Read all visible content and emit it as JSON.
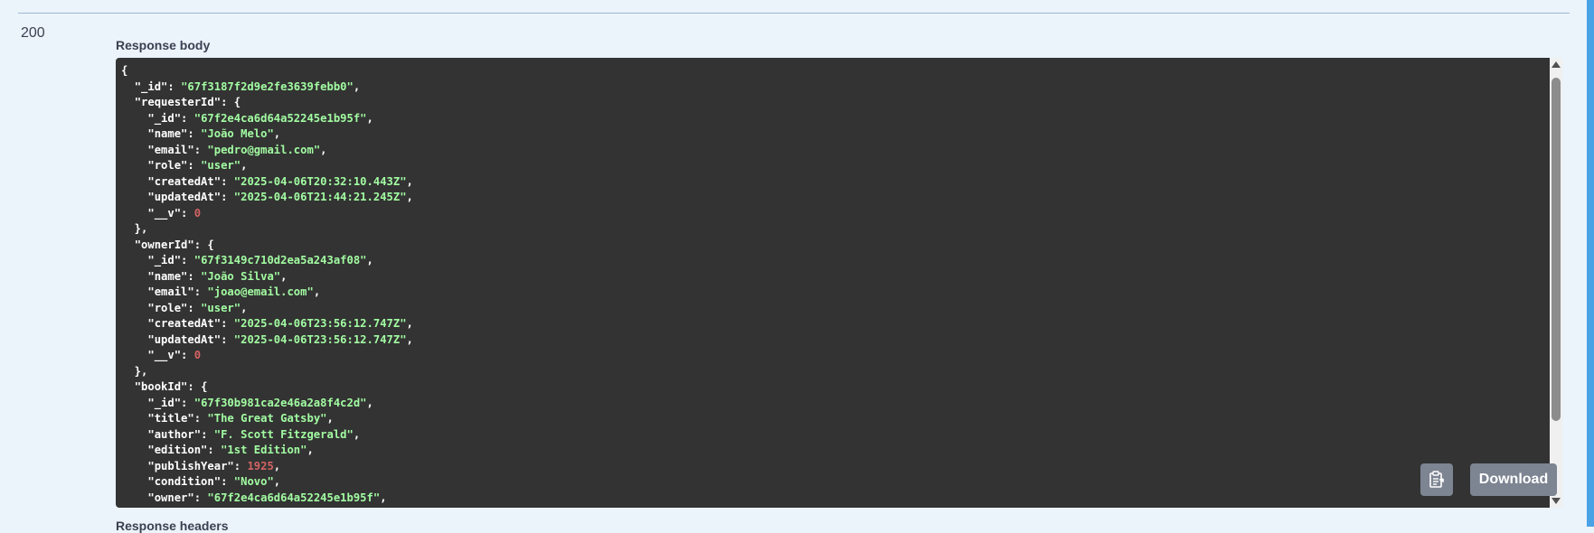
{
  "response": {
    "status_code": "200",
    "body_label": "Response body",
    "headers_label": "Response headers",
    "download_label": "Download"
  },
  "icons": {
    "copy": "clipboard-icon",
    "scroll_up": "scroll-up-arrow-icon",
    "scroll_down": "scroll-down-arrow-icon"
  },
  "colors": {
    "code_background": "#333333",
    "string_value": "#a2fca2",
    "number_value": "#d36363",
    "key_text": "#ffffff",
    "button_background": "#7d8492"
  },
  "json_lines": [
    [
      {
        "t": "p",
        "v": "{"
      }
    ],
    [
      {
        "t": "p",
        "v": "  "
      },
      {
        "t": "k",
        "v": "\"_id\""
      },
      {
        "t": "p",
        "v": ": "
      },
      {
        "t": "s",
        "v": "\"67f3187f2d9e2fe3639febb0\""
      },
      {
        "t": "p",
        "v": ","
      }
    ],
    [
      {
        "t": "p",
        "v": "  "
      },
      {
        "t": "k",
        "v": "\"requesterId\""
      },
      {
        "t": "p",
        "v": ": {"
      }
    ],
    [
      {
        "t": "p",
        "v": "    "
      },
      {
        "t": "k",
        "v": "\"_id\""
      },
      {
        "t": "p",
        "v": ": "
      },
      {
        "t": "s",
        "v": "\"67f2e4ca6d64a52245e1b95f\""
      },
      {
        "t": "p",
        "v": ","
      }
    ],
    [
      {
        "t": "p",
        "v": "    "
      },
      {
        "t": "k",
        "v": "\"name\""
      },
      {
        "t": "p",
        "v": ": "
      },
      {
        "t": "s",
        "v": "\"João Melo\""
      },
      {
        "t": "p",
        "v": ","
      }
    ],
    [
      {
        "t": "p",
        "v": "    "
      },
      {
        "t": "k",
        "v": "\"email\""
      },
      {
        "t": "p",
        "v": ": "
      },
      {
        "t": "s",
        "v": "\"pedro@gmail.com\""
      },
      {
        "t": "p",
        "v": ","
      }
    ],
    [
      {
        "t": "p",
        "v": "    "
      },
      {
        "t": "k",
        "v": "\"role\""
      },
      {
        "t": "p",
        "v": ": "
      },
      {
        "t": "s",
        "v": "\"user\""
      },
      {
        "t": "p",
        "v": ","
      }
    ],
    [
      {
        "t": "p",
        "v": "    "
      },
      {
        "t": "k",
        "v": "\"createdAt\""
      },
      {
        "t": "p",
        "v": ": "
      },
      {
        "t": "s",
        "v": "\"2025-04-06T20:32:10.443Z\""
      },
      {
        "t": "p",
        "v": ","
      }
    ],
    [
      {
        "t": "p",
        "v": "    "
      },
      {
        "t": "k",
        "v": "\"updatedAt\""
      },
      {
        "t": "p",
        "v": ": "
      },
      {
        "t": "s",
        "v": "\"2025-04-06T21:44:21.245Z\""
      },
      {
        "t": "p",
        "v": ","
      }
    ],
    [
      {
        "t": "p",
        "v": "    "
      },
      {
        "t": "k",
        "v": "\"__v\""
      },
      {
        "t": "p",
        "v": ": "
      },
      {
        "t": "n",
        "v": "0"
      }
    ],
    [
      {
        "t": "p",
        "v": "  },"
      }
    ],
    [
      {
        "t": "p",
        "v": "  "
      },
      {
        "t": "k",
        "v": "\"ownerId\""
      },
      {
        "t": "p",
        "v": ": {"
      }
    ],
    [
      {
        "t": "p",
        "v": "    "
      },
      {
        "t": "k",
        "v": "\"_id\""
      },
      {
        "t": "p",
        "v": ": "
      },
      {
        "t": "s",
        "v": "\"67f3149c710d2ea5a243af08\""
      },
      {
        "t": "p",
        "v": ","
      }
    ],
    [
      {
        "t": "p",
        "v": "    "
      },
      {
        "t": "k",
        "v": "\"name\""
      },
      {
        "t": "p",
        "v": ": "
      },
      {
        "t": "s",
        "v": "\"João Silva\""
      },
      {
        "t": "p",
        "v": ","
      }
    ],
    [
      {
        "t": "p",
        "v": "    "
      },
      {
        "t": "k",
        "v": "\"email\""
      },
      {
        "t": "p",
        "v": ": "
      },
      {
        "t": "s",
        "v": "\"joao@email.com\""
      },
      {
        "t": "p",
        "v": ","
      }
    ],
    [
      {
        "t": "p",
        "v": "    "
      },
      {
        "t": "k",
        "v": "\"role\""
      },
      {
        "t": "p",
        "v": ": "
      },
      {
        "t": "s",
        "v": "\"user\""
      },
      {
        "t": "p",
        "v": ","
      }
    ],
    [
      {
        "t": "p",
        "v": "    "
      },
      {
        "t": "k",
        "v": "\"createdAt\""
      },
      {
        "t": "p",
        "v": ": "
      },
      {
        "t": "s",
        "v": "\"2025-04-06T23:56:12.747Z\""
      },
      {
        "t": "p",
        "v": ","
      }
    ],
    [
      {
        "t": "p",
        "v": "    "
      },
      {
        "t": "k",
        "v": "\"updatedAt\""
      },
      {
        "t": "p",
        "v": ": "
      },
      {
        "t": "s",
        "v": "\"2025-04-06T23:56:12.747Z\""
      },
      {
        "t": "p",
        "v": ","
      }
    ],
    [
      {
        "t": "p",
        "v": "    "
      },
      {
        "t": "k",
        "v": "\"__v\""
      },
      {
        "t": "p",
        "v": ": "
      },
      {
        "t": "n",
        "v": "0"
      }
    ],
    [
      {
        "t": "p",
        "v": "  },"
      }
    ],
    [
      {
        "t": "p",
        "v": "  "
      },
      {
        "t": "k",
        "v": "\"bookId\""
      },
      {
        "t": "p",
        "v": ": {"
      }
    ],
    [
      {
        "t": "p",
        "v": "    "
      },
      {
        "t": "k",
        "v": "\"_id\""
      },
      {
        "t": "p",
        "v": ": "
      },
      {
        "t": "s",
        "v": "\"67f30b981ca2e46a2a8f4c2d\""
      },
      {
        "t": "p",
        "v": ","
      }
    ],
    [
      {
        "t": "p",
        "v": "    "
      },
      {
        "t": "k",
        "v": "\"title\""
      },
      {
        "t": "p",
        "v": ": "
      },
      {
        "t": "s",
        "v": "\"The Great Gatsby\""
      },
      {
        "t": "p",
        "v": ","
      }
    ],
    [
      {
        "t": "p",
        "v": "    "
      },
      {
        "t": "k",
        "v": "\"author\""
      },
      {
        "t": "p",
        "v": ": "
      },
      {
        "t": "s",
        "v": "\"F. Scott Fitzgerald\""
      },
      {
        "t": "p",
        "v": ","
      }
    ],
    [
      {
        "t": "p",
        "v": "    "
      },
      {
        "t": "k",
        "v": "\"edition\""
      },
      {
        "t": "p",
        "v": ": "
      },
      {
        "t": "s",
        "v": "\"1st Edition\""
      },
      {
        "t": "p",
        "v": ","
      }
    ],
    [
      {
        "t": "p",
        "v": "    "
      },
      {
        "t": "k",
        "v": "\"publishYear\""
      },
      {
        "t": "p",
        "v": ": "
      },
      {
        "t": "n",
        "v": "1925"
      },
      {
        "t": "p",
        "v": ","
      }
    ],
    [
      {
        "t": "p",
        "v": "    "
      },
      {
        "t": "k",
        "v": "\"condition\""
      },
      {
        "t": "p",
        "v": ": "
      },
      {
        "t": "s",
        "v": "\"Novo\""
      },
      {
        "t": "p",
        "v": ","
      }
    ],
    [
      {
        "t": "p",
        "v": "    "
      },
      {
        "t": "k",
        "v": "\"owner\""
      },
      {
        "t": "p",
        "v": ": "
      },
      {
        "t": "s",
        "v": "\"67f2e4ca6d64a52245e1b95f\""
      },
      {
        "t": "p",
        "v": ","
      }
    ]
  ]
}
